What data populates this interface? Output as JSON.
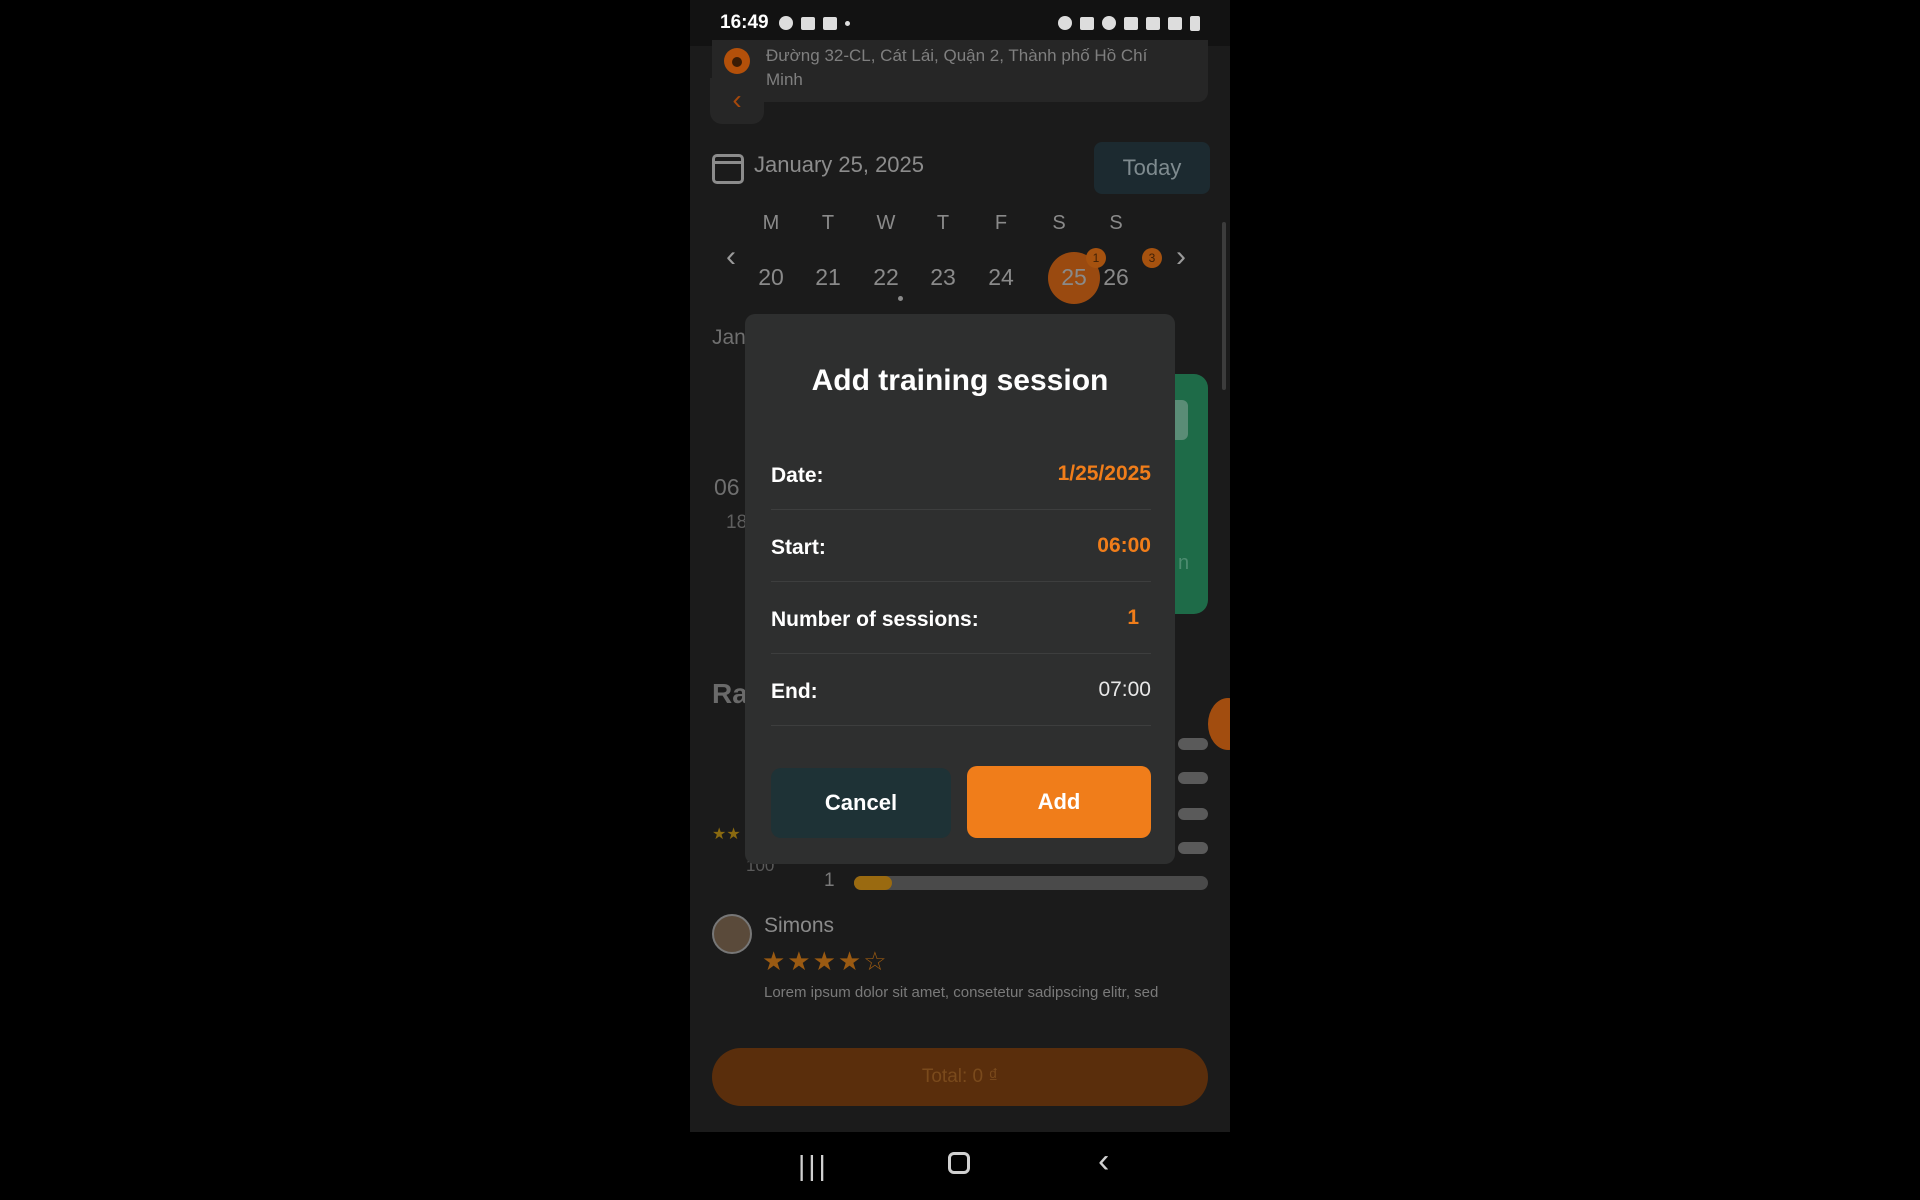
{
  "status_bar": {
    "time": "16:49"
  },
  "location": {
    "address": "Đường 32-CL, Cát Lái, Quận 2, Thành phố Hồ Chí Minh"
  },
  "calendar": {
    "current_date": "January 25, 2025",
    "today_label": "Today",
    "weekdays": [
      "M",
      "T",
      "W",
      "T",
      "F",
      "S",
      "S"
    ],
    "days": [
      "20",
      "21",
      "22",
      "23",
      "24",
      "25",
      "26"
    ],
    "selected_day": "25",
    "badges": {
      "day25": "1",
      "day26": "3"
    }
  },
  "background": {
    "jan_text": "Jan",
    "time_start": "06",
    "time_end": "18",
    "card_letter": "n",
    "ratings_heading": "Ra",
    "rating_count": "100",
    "rating_row_label": "1"
  },
  "review": {
    "name": "Simons",
    "stars": "★★★★☆",
    "text": "Lorem ipsum dolor sit amet, consetetur sadipscing elitr, sed"
  },
  "total_button": "Total: 0 ₫",
  "dialog": {
    "title": "Add training session",
    "date_label": "Date:",
    "date_value": "1/25/2025",
    "start_label": "Start:",
    "start_value": "06:00",
    "sessions_label": "Number of sessions:",
    "sessions_value": "1",
    "end_label": "End:",
    "end_value": "07:00",
    "cancel_label": "Cancel",
    "add_label": "Add"
  },
  "colors": {
    "accent": "#f07d1a",
    "background": "#1b1b1b",
    "dialog": "#2e2f2f"
  }
}
